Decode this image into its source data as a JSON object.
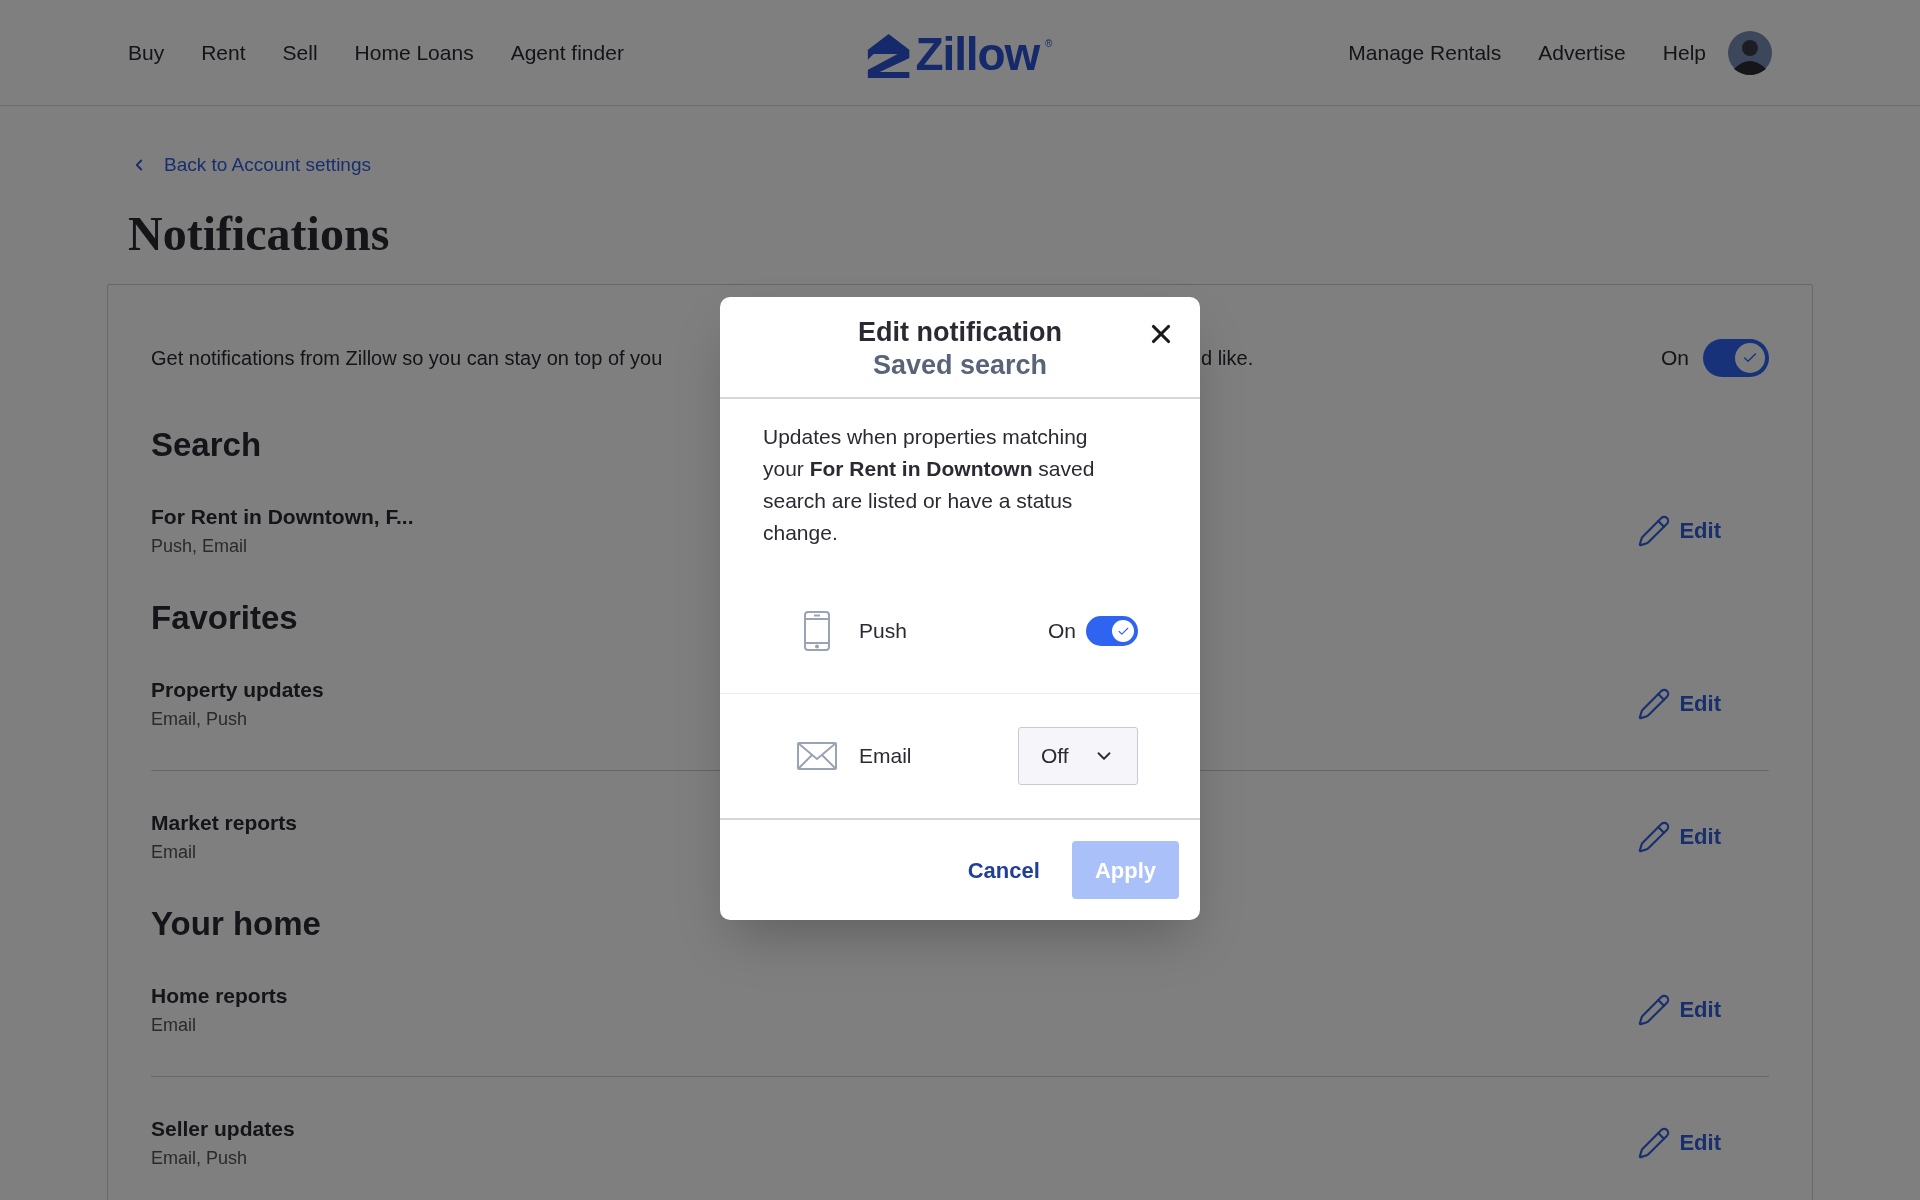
{
  "header": {
    "nav_left": [
      "Buy",
      "Rent",
      "Sell",
      "Home Loans",
      "Agent finder"
    ],
    "logo": {
      "text": "Zillow",
      "mark": "®"
    },
    "nav_right": [
      "Manage Rentals",
      "Advertise",
      "Help"
    ]
  },
  "back_link": "Back to Account settings",
  "page_title": "Notifications",
  "card": {
    "description_parts": [
      "Get notifications from Zillow so you can stay on top of you",
      "d like."
    ],
    "master": {
      "label": "On",
      "on": true
    },
    "sections": [
      {
        "heading": "Search",
        "items": [
          {
            "title": "For Rent in Downtown, F...",
            "channels": "Push, Email",
            "edit": "Edit"
          }
        ]
      },
      {
        "heading": "Favorites",
        "items": [
          {
            "title": "Property updates",
            "channels": "Email, Push",
            "edit": "Edit"
          },
          {
            "title": "Market reports",
            "channels": "Email",
            "edit": "Edit"
          }
        ]
      },
      {
        "heading": "Your home",
        "items": [
          {
            "title": "Home reports",
            "channels": "Email",
            "edit": "Edit"
          },
          {
            "title": "Seller updates",
            "channels": "Email, Push",
            "edit": "Edit"
          }
        ]
      }
    ]
  },
  "modal": {
    "title": "Edit notification",
    "subtitle": "Saved search",
    "description": "Updates when properties matching your **For Rent in Downtown** saved search are listed or have a status change.",
    "channels": [
      {
        "kind": "toggle",
        "label": "Push",
        "state_label": "On",
        "on": true
      },
      {
        "kind": "select",
        "label": "Email",
        "value": "Off"
      }
    ],
    "cancel": "Cancel",
    "apply": {
      "label": "Apply",
      "disabled": true
    }
  }
}
